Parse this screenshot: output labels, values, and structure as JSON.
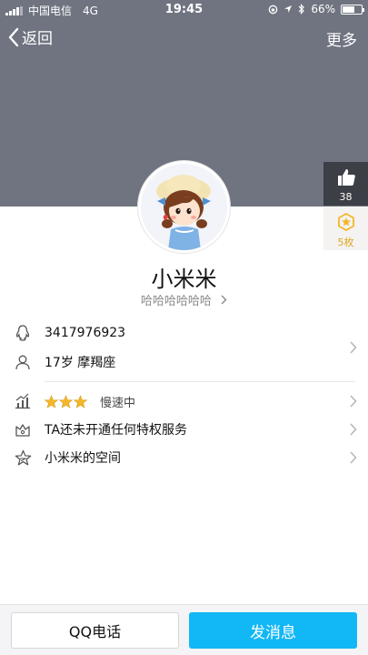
{
  "status_bar": {
    "carrier": "中国电信",
    "network": "4G",
    "time": "19:45",
    "battery": "66%",
    "battery_level": 0.66
  },
  "nav": {
    "back_label": "返回",
    "more_label": "更多"
  },
  "side": {
    "like_count": "38",
    "star_count": "5枚"
  },
  "profile": {
    "name": "小米米",
    "signature": "哈哈哈哈哈哈"
  },
  "info": {
    "qq_number": "3417976923",
    "age_sign": "17岁  摩羯座",
    "level_stars": 3,
    "speed": "慢速中",
    "privilege": "TA还未开通任何特权服务",
    "space": "小米米的空间"
  },
  "actions": {
    "call": "QQ电话",
    "message": "发消息"
  },
  "colors": {
    "header": "#6f7480",
    "primary": "#12b7f5",
    "star": "#f5b72a"
  }
}
